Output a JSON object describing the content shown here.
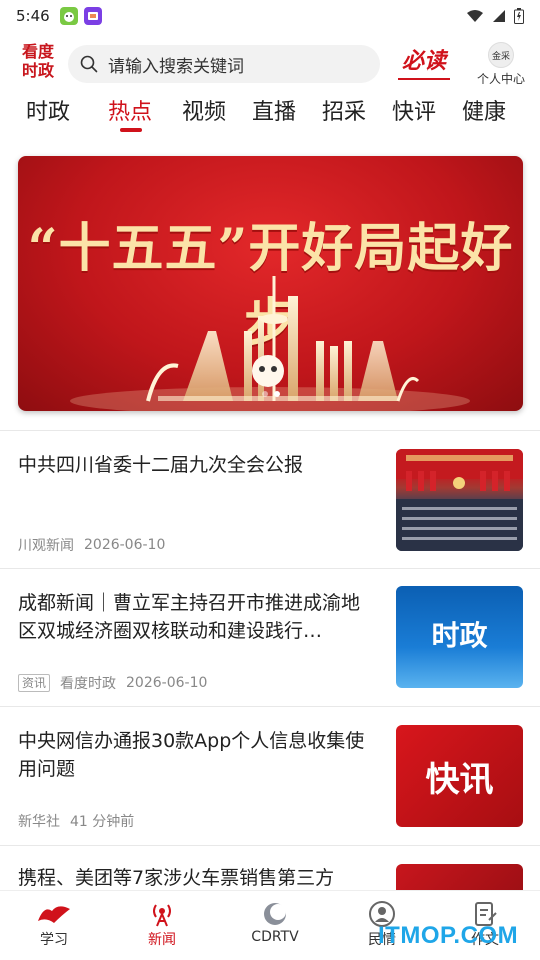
{
  "status_bar": {
    "time": "5:46"
  },
  "header": {
    "logo_line1": "看度",
    "logo_line2": "时政",
    "search_placeholder": "请输入搜索关键词",
    "bidu_label": "必读",
    "avatar_text": "金采",
    "user_center_label": "个人中心"
  },
  "tabs": [
    {
      "label": "时政"
    },
    {
      "label": "热点"
    },
    {
      "label": "视频"
    },
    {
      "label": "直播"
    },
    {
      "label": "招采"
    },
    {
      "label": "快评"
    },
    {
      "label": "健康"
    }
  ],
  "active_tab": "热点",
  "banner": {
    "title": "“十五五”开好局起好步"
  },
  "news": [
    {
      "title": "中共四川省委十二届九次全会公报",
      "source": "川观新闻",
      "time": "2026-06-10",
      "tag": ""
    },
    {
      "title": "成都新闻｜曹立军主持召开市推进成渝地区双城经济圈双核联动和建设践行…",
      "source": "看度时政",
      "time": "2026-06-10",
      "tag": "资讯",
      "thumb_text": "时政"
    },
    {
      "title": "中央网信办通报30款App个人信息收集使用问题",
      "source": "新华社",
      "time": "41 分钟前",
      "tag": "",
      "thumb_text": "快讯"
    },
    {
      "title": "携程、美团等7家涉火车票销售第三方",
      "source": "",
      "time": "",
      "tag": ""
    }
  ],
  "bottom_nav": [
    {
      "label": "学习"
    },
    {
      "label": "新闻"
    },
    {
      "label": "CDRTV"
    },
    {
      "label": "民情"
    },
    {
      "label": "作文"
    }
  ],
  "watermark": "ITMOP.COM",
  "colors": {
    "accent": "#d0121b",
    "text": "#222222",
    "meta": "#888888"
  }
}
